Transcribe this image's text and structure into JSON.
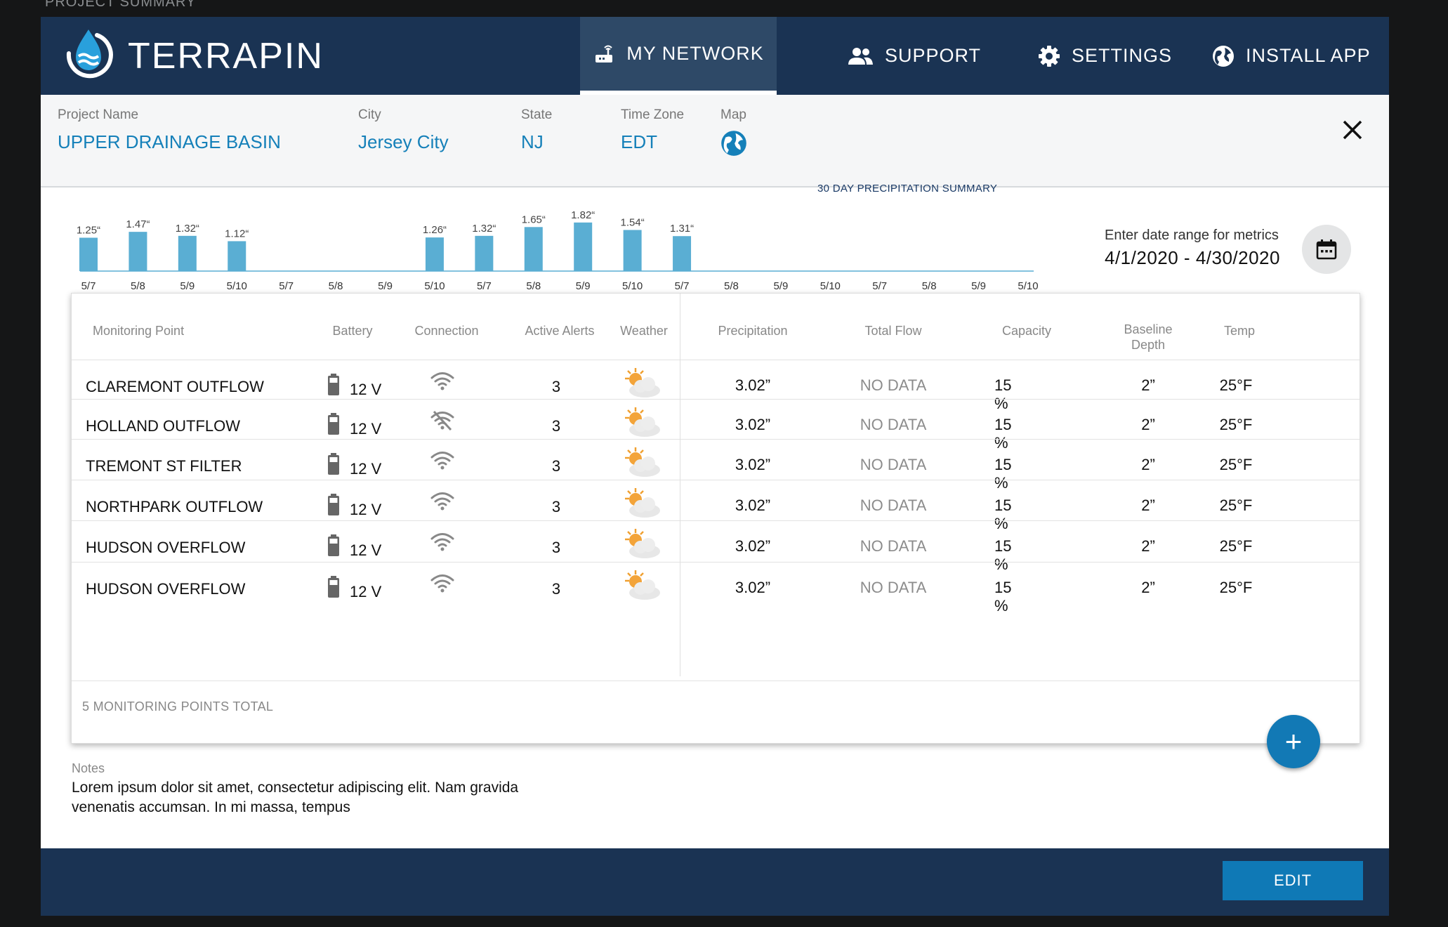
{
  "page_caption": "PROJECT SUMMARY",
  "header": {
    "brand": "TERRAPIN",
    "nav": [
      {
        "label": "MY NETWORK",
        "icon": "router-icon",
        "active": true
      },
      {
        "label": "SUPPORT",
        "icon": "people-icon"
      },
      {
        "label": "SETTINGS",
        "icon": "gear-icon"
      },
      {
        "label": "INSTALL APP",
        "icon": "globe-icon"
      }
    ]
  },
  "project": {
    "name_label": "Project  Name",
    "name": "UPPER DRAINAGE BASIN",
    "city_label": "City",
    "city": "Jersey City",
    "state_label": "State",
    "state": "NJ",
    "tz_label": "Time Zone",
    "tz": "EDT",
    "map_label": "Map"
  },
  "date_range": {
    "label": "Enter date range for metrics",
    "value": "4/1/2020 - 4/30/2020"
  },
  "chart_data": {
    "type": "bar",
    "title": "30 DAY PRECIPITATION SUMMARY",
    "categories": [
      "5/7",
      "5/8",
      "5/9",
      "5/10",
      "5/7",
      "5/8",
      "5/9",
      "5/10",
      "5/7",
      "5/8",
      "5/9",
      "5/10",
      "5/7",
      "5/8",
      "5/9",
      "5/10",
      "5/7",
      "5/8",
      "5/9",
      "5/10"
    ],
    "values": [
      1.25,
      1.47,
      1.32,
      1.12,
      null,
      null,
      null,
      1.26,
      1.32,
      1.65,
      1.82,
      1.54,
      1.31,
      null,
      null,
      null,
      null,
      null,
      null,
      null
    ],
    "data_labels": [
      "1.25“",
      "1.47“",
      "1.32“",
      "1.12“",
      "",
      "",
      "",
      "1.26“",
      "1.32“",
      "1.65“",
      "1.82“",
      "1.54“",
      "1.31“",
      "",
      "",
      "",
      "",
      "",
      "",
      ""
    ],
    "xlabel": "",
    "ylabel": "",
    "bar_color": "#5aaed3",
    "grid": false
  },
  "table": {
    "columns": [
      "Monitoring Point",
      "Battery",
      "Connection",
      "Active Alerts",
      "Weather",
      "Precipitation",
      "Total Flow",
      "Capacity",
      "Baseline Depth",
      "Temp"
    ],
    "rows": [
      {
        "name": "CLAREMONT OUTFLOW",
        "battery": "12 V",
        "connection": "wifi-icon",
        "alerts": "3",
        "weather": "partly-cloudy-icon",
        "precip": "3.02”",
        "flow": "NO DATA",
        "capacity": "15",
        "capacity_unit": "%",
        "depth": "2”",
        "temp": "25°F"
      },
      {
        "name": "HOLLAND OUTFLOW",
        "battery": "12 V",
        "connection": "wifi-off-icon",
        "alerts": "3",
        "weather": "partly-cloudy-icon",
        "precip": "3.02”",
        "flow": "NO DATA",
        "capacity": "15",
        "capacity_unit": "%",
        "depth": "2”",
        "temp": "25°F"
      },
      {
        "name": "TREMONT ST FILTER",
        "battery": "12 V",
        "connection": "wifi-icon",
        "alerts": "3",
        "weather": "partly-cloudy-icon",
        "precip": "3.02”",
        "flow": "NO DATA",
        "capacity": "15",
        "capacity_unit": "%",
        "depth": "2”",
        "temp": "25°F"
      },
      {
        "name": "NORTHPARK OUTFLOW",
        "battery": "12 V",
        "connection": "wifi-icon",
        "alerts": "3",
        "weather": "partly-cloudy-icon",
        "precip": "3.02”",
        "flow": "NO DATA",
        "capacity": "15",
        "capacity_unit": "%",
        "depth": "2”",
        "temp": "25°F"
      },
      {
        "name": "HUDSON OVERFLOW",
        "battery": "12 V",
        "connection": "wifi-icon",
        "alerts": "3",
        "weather": "partly-cloudy-icon",
        "precip": "3.02”",
        "flow": "NO DATA",
        "capacity": "15",
        "capacity_unit": "%",
        "depth": "2”",
        "temp": "25°F"
      },
      {
        "name": "HUDSON OVERFLOW",
        "battery": "12 V",
        "connection": "wifi-icon",
        "alerts": "3",
        "weather": "partly-cloudy-icon",
        "precip": "3.02”",
        "flow": "NO DATA",
        "capacity": "15",
        "capacity_unit": "%",
        "depth": "2”",
        "temp": "25°F"
      }
    ],
    "footer": "5 MONITORING POINTS TOTAL"
  },
  "add_button": "+",
  "notes": {
    "label": "Notes",
    "text": "Lorem ipsum dolor sit amet, consectetur  adipiscing elit. Nam gravida venenatis accumsan. In mi massa, tempus"
  },
  "edit_button": "EDIT",
  "colors": {
    "header": "#1a3353",
    "accent": "#1580b9",
    "bar": "#5aaed3",
    "button": "#0f79b6"
  }
}
